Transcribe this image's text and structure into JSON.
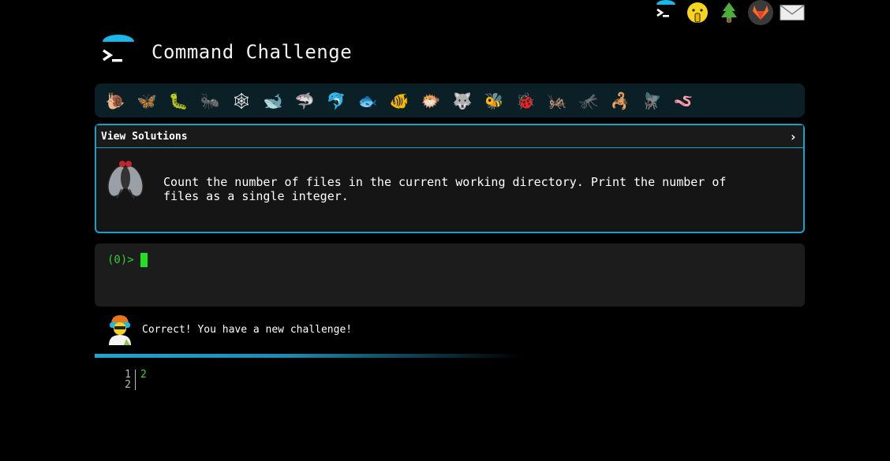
{
  "header": {
    "title": "Command Challenge"
  },
  "top_icons": [
    "prompt-icon",
    "shush-emoji-icon",
    "tree-icon",
    "gitlab-icon",
    "mail-icon"
  ],
  "critters": [
    {
      "name": "snail",
      "glyph": "🐌"
    },
    {
      "name": "butterfly",
      "glyph": "🦋"
    },
    {
      "name": "caterpillar",
      "glyph": "🐛"
    },
    {
      "name": "ant",
      "glyph": "🐜"
    },
    {
      "name": "web",
      "glyph": "🕸"
    },
    {
      "name": "whale",
      "glyph": "🐋"
    },
    {
      "name": "shark",
      "glyph": "🦈"
    },
    {
      "name": "dolphin",
      "glyph": "🐬"
    },
    {
      "name": "fish",
      "glyph": "🐟"
    },
    {
      "name": "tropical-fish",
      "glyph": "🐠"
    },
    {
      "name": "pufferfish",
      "glyph": "🐡"
    },
    {
      "name": "wolf",
      "glyph": "🐺"
    },
    {
      "name": "bee",
      "glyph": "🐝"
    },
    {
      "name": "ladybug",
      "glyph": "🐞"
    },
    {
      "name": "cricket",
      "glyph": "🦗"
    },
    {
      "name": "mosquito",
      "glyph": "🦟"
    },
    {
      "name": "scorpion",
      "glyph": "🦂"
    },
    {
      "name": "fly",
      "glyph": "🪰"
    },
    {
      "name": "worm",
      "glyph": "🪱"
    }
  ],
  "panel": {
    "heading": "View Solutions",
    "chevron": "›",
    "challenge": "Count the number of files in the current working directory. Print the number of files as a single integer."
  },
  "terminal": {
    "prompt": "(0)>"
  },
  "status": {
    "message": "Correct! You have a new challenge!"
  },
  "progress": {
    "fraction": 0.52
  },
  "output": {
    "line_numbers": [
      "1",
      "2"
    ],
    "lines": [
      "2",
      ""
    ]
  },
  "colors": {
    "accent": "#1aa2c4",
    "prompt_green": "#2fd12f",
    "background": "#000000"
  }
}
